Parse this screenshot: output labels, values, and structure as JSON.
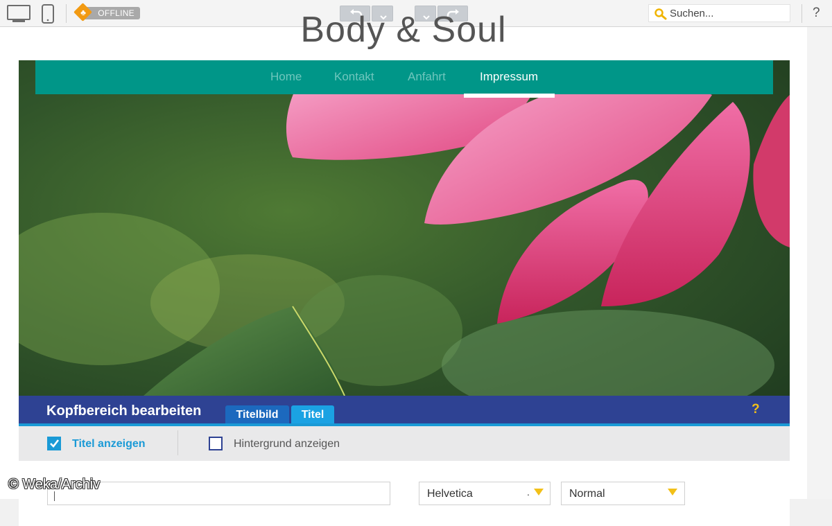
{
  "toolbar": {
    "offline_label": "OFFLINE",
    "search_placeholder": "Suchen...",
    "help_label": "?",
    "accent_color": "#f29a12"
  },
  "site": {
    "title": "Body & Soul",
    "nav": [
      "Home",
      "Kontakt",
      "Anfahrt",
      "Impressum"
    ],
    "active_nav": "Impressum",
    "nav_color": "#009688"
  },
  "editor": {
    "title": "Kopfbereich bearbeiten",
    "tabs": [
      "Titelbild",
      "Titel"
    ],
    "active_tab": "Titel",
    "help_label": "?",
    "show_title_label": "Titel anzeigen",
    "show_title_checked": true,
    "show_background_label": "Hintergrund anzeigen",
    "show_background_checked": false,
    "font_value": "Helvetica",
    "style_value": "Normal",
    "header_color": "#2e4293"
  },
  "watermark": "© Weka/Archiv"
}
